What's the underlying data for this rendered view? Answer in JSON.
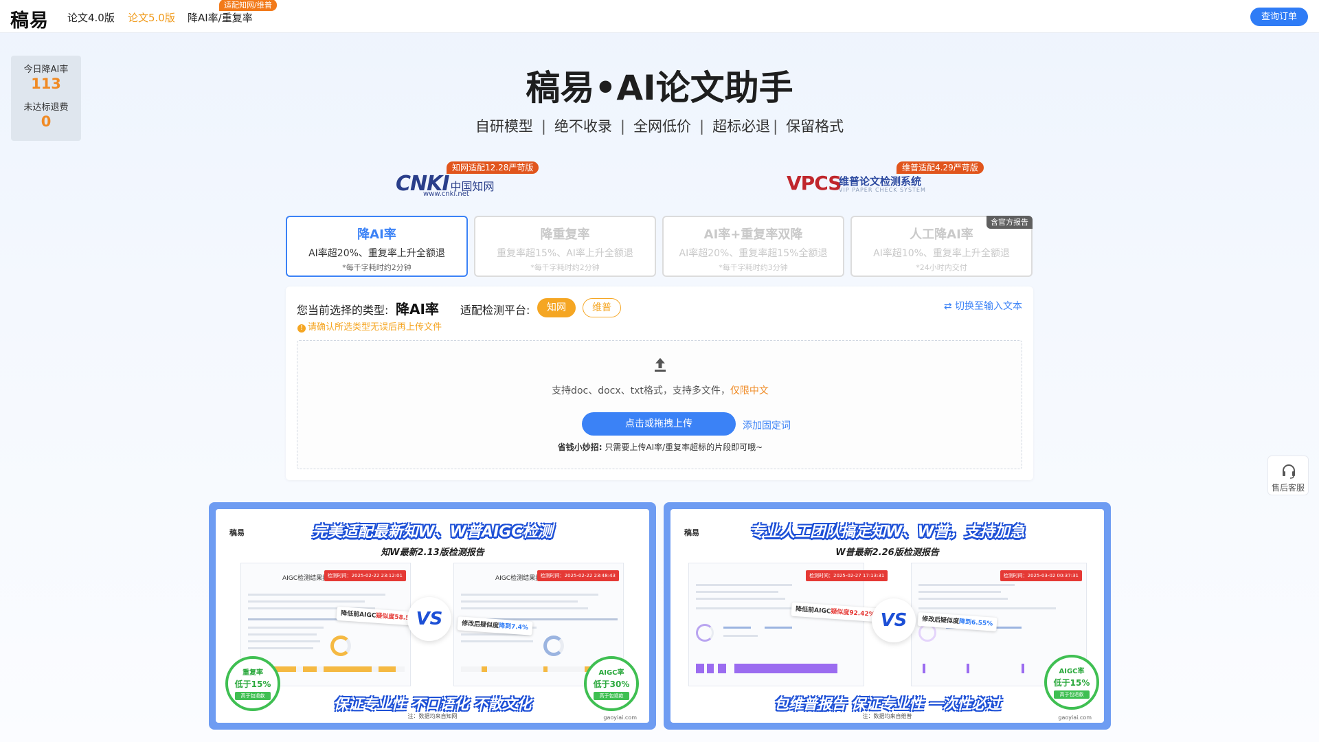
{
  "topbar": {
    "logo": "稿易",
    "nav": [
      {
        "label": "论文4.0版"
      },
      {
        "label": "论文5.0版"
      },
      {
        "label": "降AI率/重复率"
      }
    ],
    "nav_badge": "适配知网/维普",
    "order_button": "查询订单"
  },
  "stats": {
    "today_label": "今日降AI率",
    "today_value": "113",
    "refund_label": "未达标退费",
    "refund_value": "0"
  },
  "hero": {
    "title": "稿易•AI论文助手",
    "features": [
      "自研模型",
      "绝不收录",
      "全网低价",
      "超标必退",
      "保留格式"
    ]
  },
  "platforms": {
    "cnki": {
      "logo_main": "CNKI",
      "logo_cn": "中国知网",
      "logo_url": "www.cnki.net",
      "badge": "知网适配12.28严苛版"
    },
    "vip": {
      "logo_main": "VPCS",
      "name": "维普论文检测系统",
      "name_en": "VIP PAPER CHECK SYSTEM",
      "badge": "维普适配4.29严苛版"
    }
  },
  "types": [
    {
      "title": "降AI率",
      "desc": "AI率超20%、重复率上升全额退",
      "time": "*每千字耗时约2分钟"
    },
    {
      "title": "降重复率",
      "desc": "重复率超15%、AI率上升全额退",
      "time": "*每千字耗时约2分钟"
    },
    {
      "title": "AI率+重复率双降",
      "desc": "AI率超20%、重复率超15%全额退",
      "time": "*每千字耗时约3分钟"
    },
    {
      "title": "人工降AI率",
      "desc": "AI率超10%、重复率上升全额退",
      "time": "*24小时内交付",
      "tag": "含官方报告"
    }
  ],
  "panel": {
    "selected_label": "您当前选择的类型:",
    "selected_value": "降AI率",
    "platform_label": "适配检测平台:",
    "platform_on": "知网",
    "platform_off": "维普",
    "switch_link": "切换至输入文本",
    "warning": "请确认所选类型无误后再上传文件",
    "support_text": "支持doc、docx、txt格式，支持多文件，",
    "support_highlight": "仅限中文",
    "upload_button": "点击或拖拽上传",
    "fixed_words_link": "添加固定词",
    "tip_bold": "省钱小妙招:",
    "tip_text": "只需要上传AI率/重复率超标的片段即可哦~"
  },
  "support_widget": {
    "label": "售后客服",
    "icon": "headset-icon"
  },
  "banners": [
    {
      "logo": "稿易",
      "headline": "完美适配最新知W、W普AIGC检测",
      "subhead": "知W最新2.13版检测报告",
      "doc_title": "AIGC检测结果报告单",
      "time_left": "检测时间：2025-02-22 23:12:01",
      "time_right": "检测时间：2025-02-22 23:48:43",
      "callout_before_label": "降低前AIGC",
      "callout_before_value": "疑似度58.5%",
      "callout_after_label": "修改后疑似度",
      "callout_after_value": "降到7.4%",
      "vs": "VS",
      "stamp_left": {
        "line1": "重复率",
        "line2": "低于15%",
        "line3": "高于包退款"
      },
      "stamp_right": {
        "line1": "AIGC率",
        "line2": "低于30%",
        "line3": "高于包退款"
      },
      "footer": "保证专业性  不口语化  不散文化",
      "note": "注：数据均来自知网",
      "url": "gaoyiai.com"
    },
    {
      "logo": "稿易",
      "headline": "专业人工团队搞定知W、W普，支持加急",
      "subhead": "W普最新2.26版检测报告",
      "doc_title": "",
      "time_left": "检测时间：2025-02-27 17:13:31",
      "time_right": "检测时间：2025-03-02 00:37:31",
      "callout_before_label": "降低前AIGC",
      "callout_before_value": "疑似度92.42%",
      "callout_after_label": "修改后疑似度",
      "callout_after_value": "降到6.55%",
      "vs": "VS",
      "stamp_left": null,
      "stamp_right": {
        "line1": "AIGC率",
        "line2": "低于15%",
        "line3": "高于包退款"
      },
      "footer": "包维普报告  保证专业性  一次性必过",
      "note": "注：数据均来自维普",
      "url": "gaoyiai.com"
    }
  ],
  "colors": {
    "accent_blue": "#3b82f6",
    "accent_orange": "#f5a623",
    "banner_frame": "#6e9cf2",
    "badge_red": "#e1551d"
  }
}
